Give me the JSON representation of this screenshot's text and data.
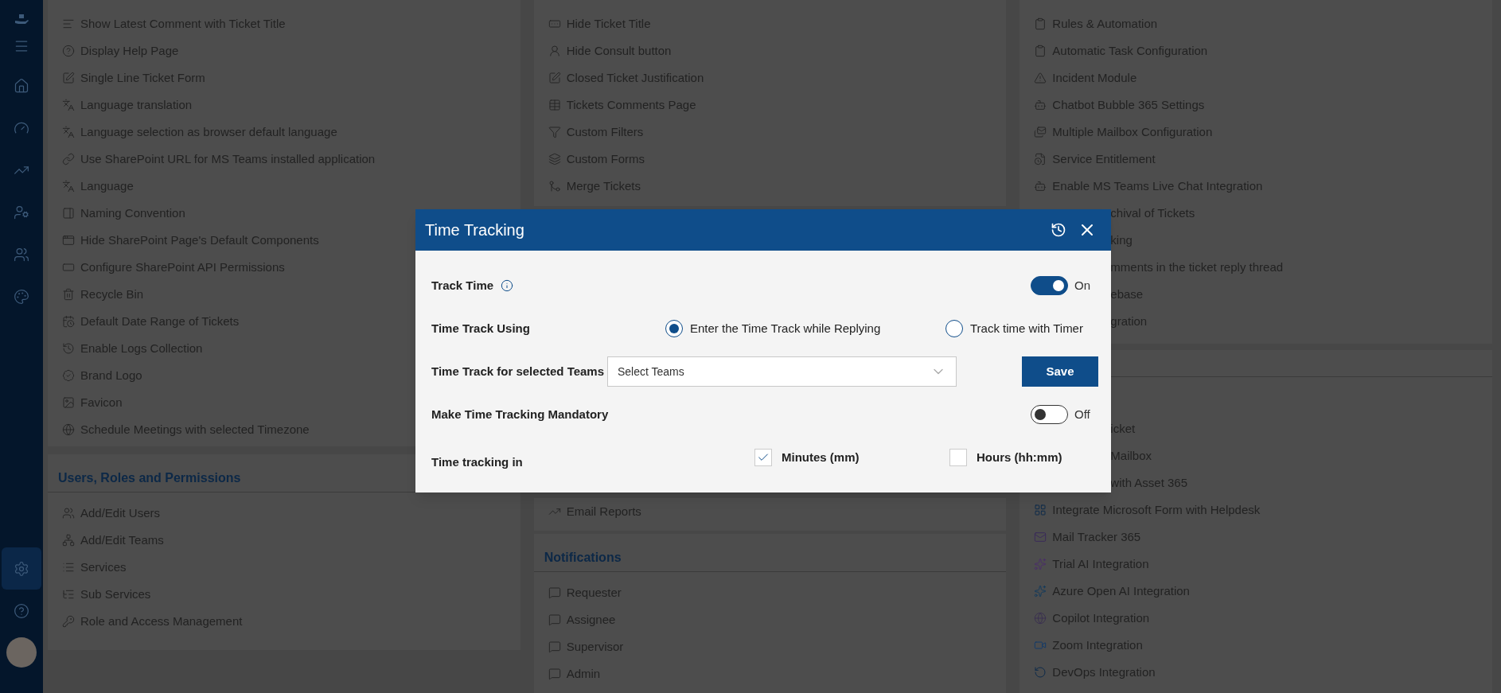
{
  "sidebar": {
    "items": [
      {
        "selected": false
      },
      {
        "selected": false
      },
      {
        "selected": false
      },
      {
        "selected": false
      },
      {
        "selected": false
      },
      {
        "selected": false
      },
      {
        "selected": false
      }
    ],
    "bottom_items": [
      {
        "selected": true
      },
      {
        "selected": false
      }
    ]
  },
  "columns": [
    {
      "groups": [
        {
          "items": [
            {
              "kind": "full",
              "text": "Show Latest Comment with Ticket Title"
            },
            {
              "kind": "full",
              "text": "Display Help Page"
            },
            {
              "kind": "full",
              "text": "Single Line Ticket Form"
            },
            {
              "kind": "full",
              "text": "Language translation"
            },
            {
              "kind": "full",
              "text": "Language selection as browser default language"
            },
            {
              "kind": "full",
              "text": "Use SharePoint URL for MS Teams installed application"
            },
            {
              "kind": "full",
              "text": "Language"
            },
            {
              "kind": "full",
              "text": "Naming Convention"
            },
            {
              "kind": "full",
              "text": "Hide SharePoint Page's Default Components"
            },
            {
              "kind": "full",
              "text": "Configure SharePoint API Permissions"
            },
            {
              "kind": "full",
              "text": "Recycle Bin"
            },
            {
              "kind": "full",
              "text": "Default Date Range of Tickets"
            },
            {
              "kind": "full",
              "text": "Enable Logs Collection"
            },
            {
              "kind": "full",
              "text": "Brand Logo"
            },
            {
              "kind": "full",
              "text": "Favicon"
            },
            {
              "kind": "full",
              "text": "Schedule Meetings with selected Timezone"
            }
          ]
        },
        {
          "title": "Users, Roles and Permissions",
          "items": [
            {
              "kind": "full",
              "text": "Add/Edit Users"
            },
            {
              "kind": "full",
              "text": "Add/Edit Teams"
            },
            {
              "kind": "full",
              "text": "Services"
            },
            {
              "kind": "full",
              "text": "Sub Services"
            },
            {
              "kind": "full",
              "text": "Role and Access Management"
            }
          ]
        }
      ]
    },
    {
      "groups": [
        {
          "items": [
            {
              "kind": "full",
              "text": "Hide Ticket Title"
            },
            {
              "kind": "full",
              "text": "Hide Consult button"
            },
            {
              "kind": "full",
              "text": "Closed Ticket Justification"
            },
            {
              "kind": "full",
              "text": "Tickets Comments Page"
            },
            {
              "kind": "full",
              "text": "Custom Filters"
            },
            {
              "kind": "full",
              "text": "Custom Forms"
            },
            {
              "kind": "full",
              "text": "Merge Tickets"
            }
          ]
        },
        {
          "items": [
            {
              "kind": "full",
              "text": "Email Reports"
            }
          ]
        },
        {
          "title": "Notifications",
          "items": [
            {
              "kind": "full",
              "text": "Requester"
            },
            {
              "kind": "full",
              "text": "Assignee"
            },
            {
              "kind": "full",
              "text": "Supervisor"
            },
            {
              "kind": "full",
              "text": "Admin"
            }
          ]
        }
      ]
    },
    {
      "groups": [
        {
          "items": [
            {
              "kind": "full",
              "text": "Rules & Automation"
            },
            {
              "kind": "full",
              "text": "Automatic Task Configuration"
            },
            {
              "kind": "full",
              "text": "Incident Module"
            },
            {
              "kind": "full",
              "text": "Chatbot Bubble 365 Settings"
            },
            {
              "kind": "full",
              "text": "Multiple Mailbox Configuration"
            },
            {
              "kind": "full",
              "text": "Service Entitlement"
            },
            {
              "kind": "full",
              "text": "Enable MS Teams Live Chat Integration"
            },
            {
              "kind": "cut",
              "text": "chival of Tickets"
            },
            {
              "kind": "cut",
              "text": "king"
            },
            {
              "kind": "cut",
              "text": "mments in the ticket reply thread"
            },
            {
              "kind": "cut",
              "text": "ebase"
            },
            {
              "kind": "cut",
              "text": "gration"
            }
          ]
        },
        {
          "items": [
            {
              "kind": "cut",
              "text": "icket"
            },
            {
              "kind": "cut",
              "text": "Mailbox"
            },
            {
              "kind": "cut",
              "text": "with Asset 365"
            },
            {
              "kind": "full",
              "text": "Integrate Microsoft Form with Helpdesk"
            },
            {
              "kind": "full",
              "text": "Mail Tracker 365"
            },
            {
              "kind": "full",
              "text": "Trial AI Integration"
            },
            {
              "kind": "full",
              "text": "Azure Open AI Integration"
            },
            {
              "kind": "full",
              "text": "Copilot Integration"
            },
            {
              "kind": "full",
              "text": "Zoom Integration"
            },
            {
              "kind": "full",
              "text": "DevOps Integration"
            }
          ]
        }
      ]
    }
  ],
  "dialog": {
    "title": "Time Tracking",
    "track_time": {
      "label": "Track Time",
      "on": true,
      "state_text": "On"
    },
    "track_using": {
      "label": "Time Track Using",
      "options": [
        {
          "label": "Enter the Time Track while Replying",
          "selected": true
        },
        {
          "label": "Track time with Timer",
          "selected": false
        }
      ]
    },
    "teams": {
      "label": "Time Track for selected Teams",
      "placeholder": "Select Teams",
      "button": "Save"
    },
    "mandatory": {
      "label": "Make Time Tracking Mandatory",
      "on": false,
      "state_text": "Off"
    },
    "units": {
      "label": "Time tracking in",
      "options": [
        {
          "label": "Minutes (mm)",
          "checked": true
        },
        {
          "label": "Hours (hh:mm)",
          "checked": false
        }
      ]
    }
  }
}
